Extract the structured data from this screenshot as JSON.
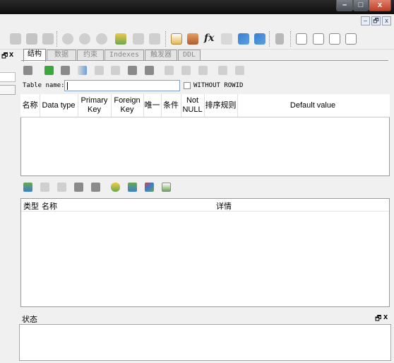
{
  "window": {
    "min_glyph": "–",
    "max_glyph": "□",
    "close_glyph": "x"
  },
  "mdi": {
    "restore_glyph": "🗗",
    "close_glyph": "x",
    "min_glyph": "–"
  },
  "left_panel": {
    "pin_glyph": "🗗",
    "close_glyph": "x"
  },
  "tabs": [
    {
      "label": "结构",
      "active": true
    },
    {
      "label": "数据",
      "active": false
    },
    {
      "label": "约束",
      "active": false
    },
    {
      "label": "Indexes",
      "active": false
    },
    {
      "label": "触发器",
      "active": false
    },
    {
      "label": "DDL",
      "active": false
    }
  ],
  "table_name": {
    "label": "Table name:",
    "value": "",
    "without_rowid_label": "WITHOUT ROWID"
  },
  "columns_grid": {
    "headers": [
      "名称",
      "Data type",
      "Primary Key",
      "Foreign Key",
      "唯一",
      "条件",
      "Not NULL",
      "排序规则",
      "Default value"
    ]
  },
  "constraints_grid": {
    "headers": [
      "类型",
      "名称",
      "详情"
    ]
  },
  "status_panel": {
    "title": "状态",
    "pin_glyph": "🗗",
    "close_glyph": "x"
  },
  "toolbar": {
    "fx_label": "fx"
  },
  "colors": {
    "accent": "#3a7fd0",
    "title_bar": "#111111",
    "close_button": "#c8452f"
  }
}
